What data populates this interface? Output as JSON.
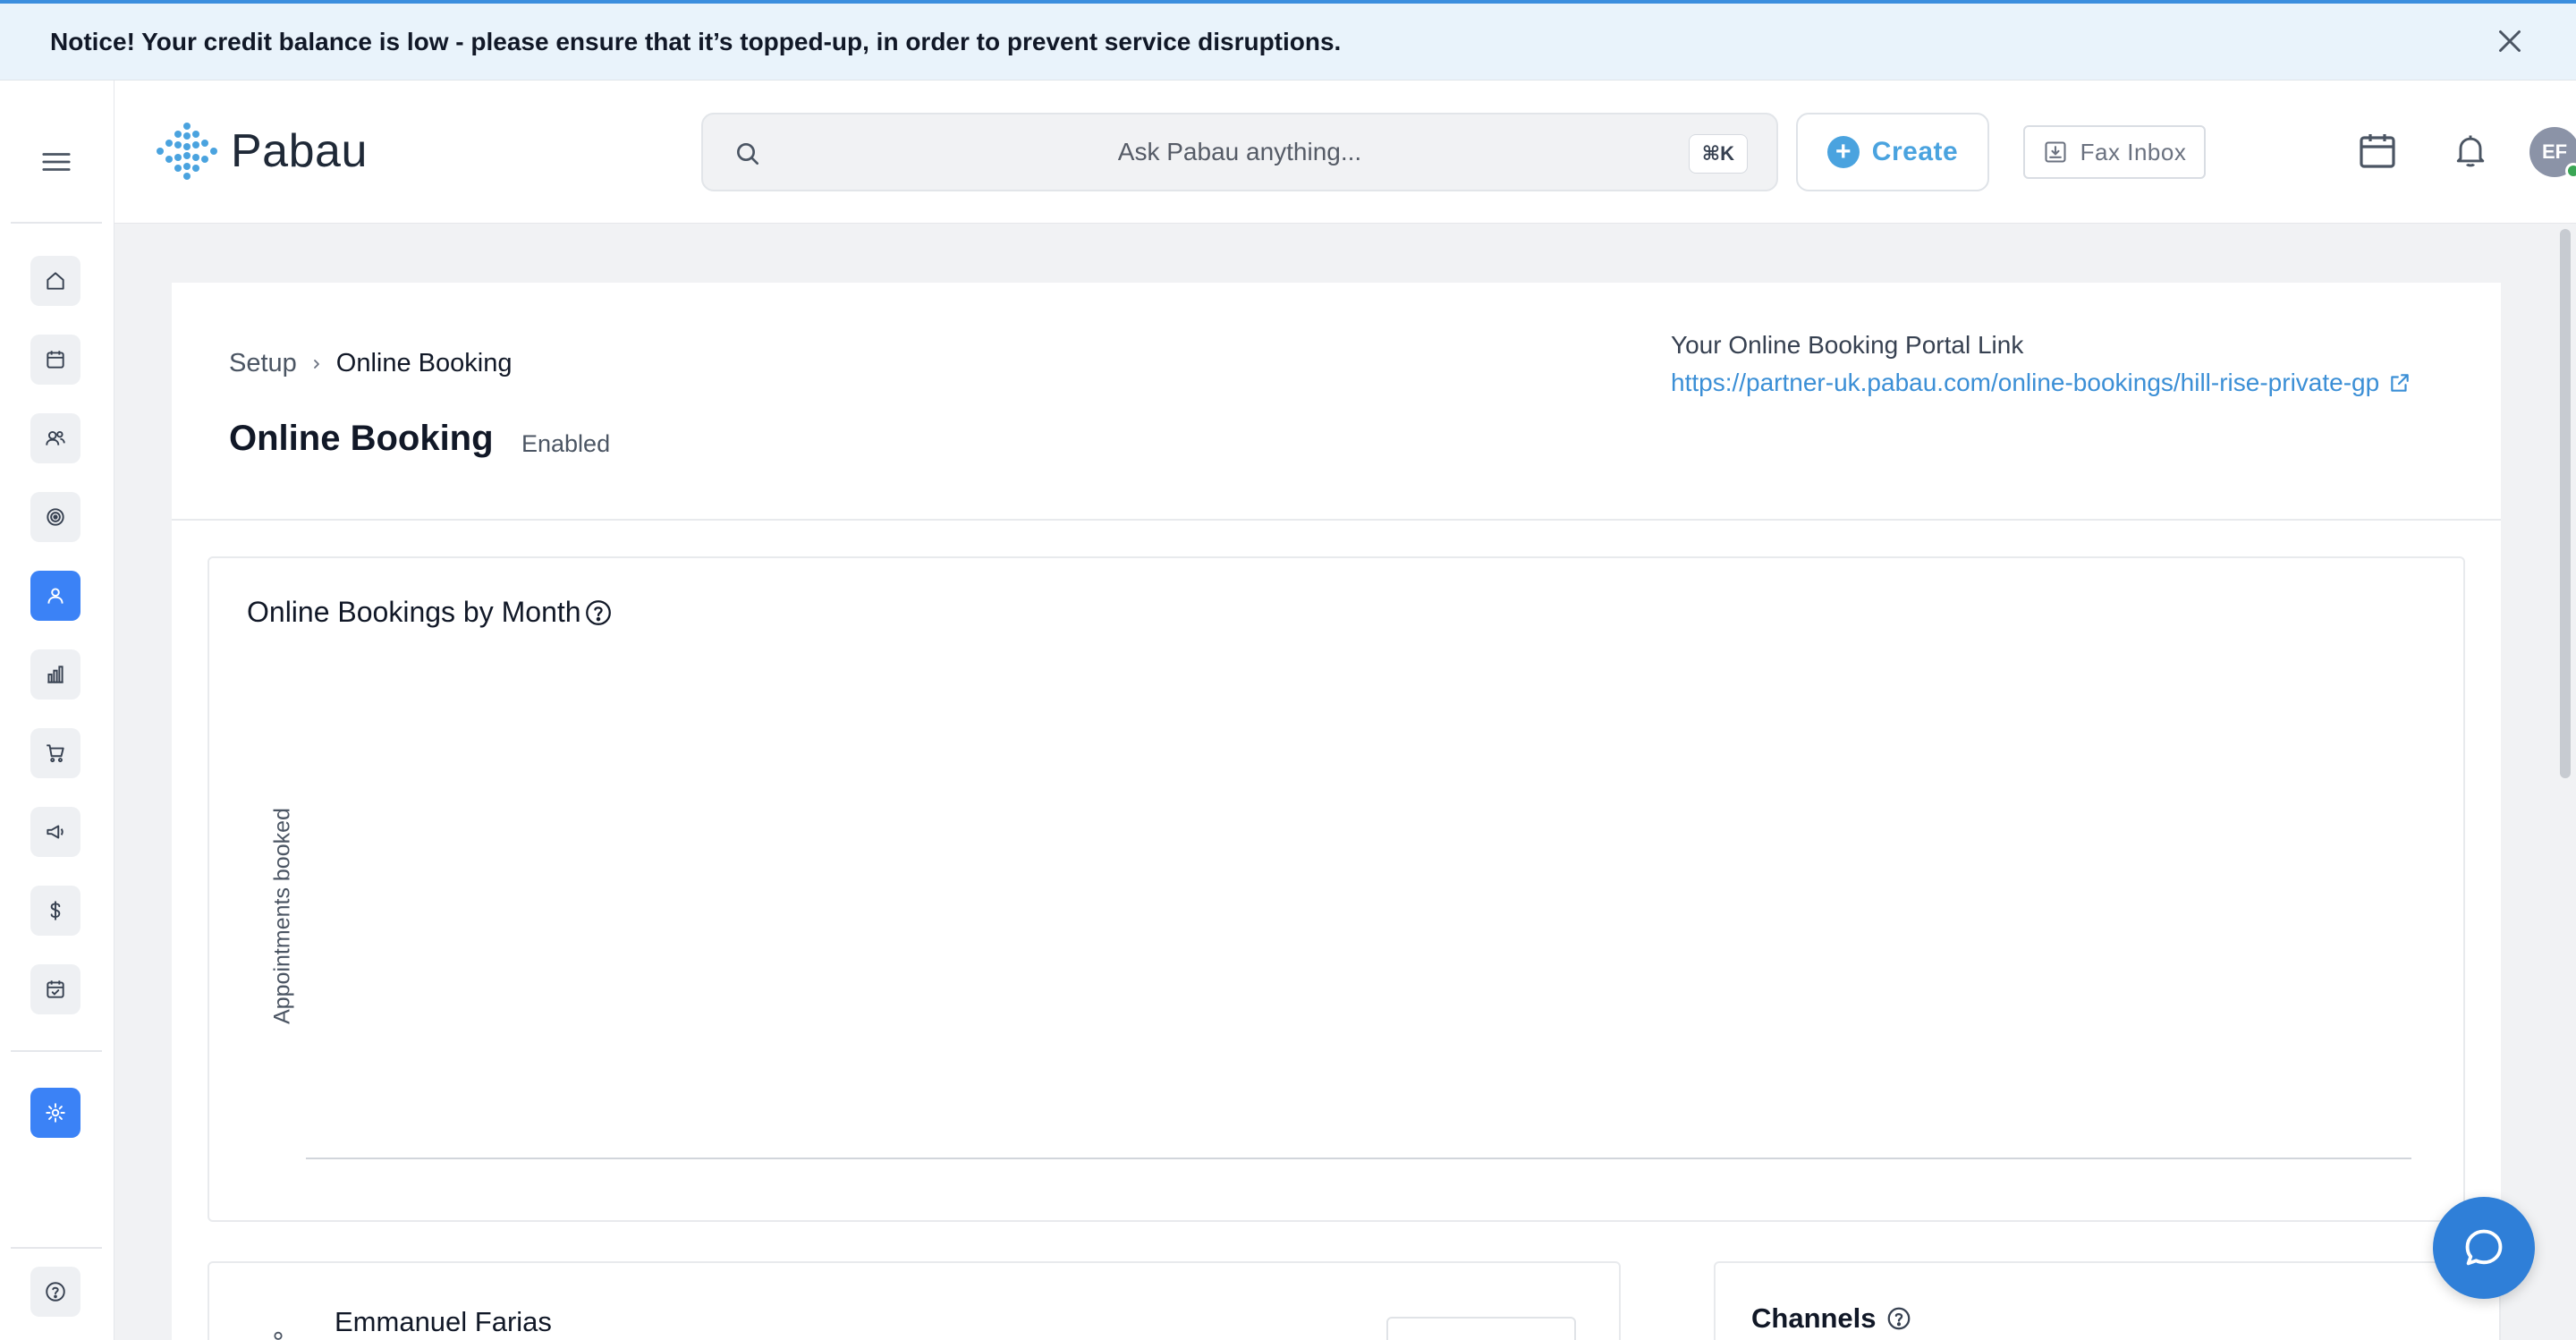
{
  "notice": {
    "text": "Notice! Your credit balance is low - please ensure that it’s topped-up, in order to prevent service disruptions."
  },
  "brand": {
    "name": "Pabau",
    "color": "#4aa3df"
  },
  "search": {
    "placeholder": "Ask Pabau anything...",
    "shortcut": "⌘K"
  },
  "header": {
    "create_label": "Create",
    "fax_label": "Fax Inbox",
    "avatar_initials": "EF",
    "avatar_status_color": "#3aa655"
  },
  "sidebar": {
    "items": [
      {
        "name": "home-icon"
      },
      {
        "name": "calendar-icon"
      },
      {
        "name": "clients-icon"
      },
      {
        "name": "target-icon"
      },
      {
        "name": "person-icon",
        "active": true
      },
      {
        "name": "reports-icon"
      },
      {
        "name": "cart-icon"
      },
      {
        "name": "megaphone-icon"
      },
      {
        "name": "dollar-icon"
      },
      {
        "name": "calendar-check-icon"
      },
      {
        "name": "settings-icon",
        "active": true
      },
      {
        "name": "help-icon"
      }
    ]
  },
  "page": {
    "breadcrumb": {
      "setup": "Setup",
      "current": "Online Booking"
    },
    "title": "Online Booking",
    "status": "Enabled",
    "portal_label": "Your Online Booking Portal Link",
    "portal_link": "https://partner-uk.pabau.com/online-bookings/hill-rise-private-gp"
  },
  "chart_data": {
    "type": "bar",
    "title": "Online Bookings by Month",
    "ylabel": "Appointments booked",
    "xlabel": "",
    "categories": [],
    "values": []
  },
  "cards": {
    "person_name": "Emmanuel Farias",
    "channels_title": "Channels"
  },
  "colors": {
    "accent": "#3b82f6",
    "link": "#3b8fd6",
    "notice_bg": "#e9f3fb"
  }
}
